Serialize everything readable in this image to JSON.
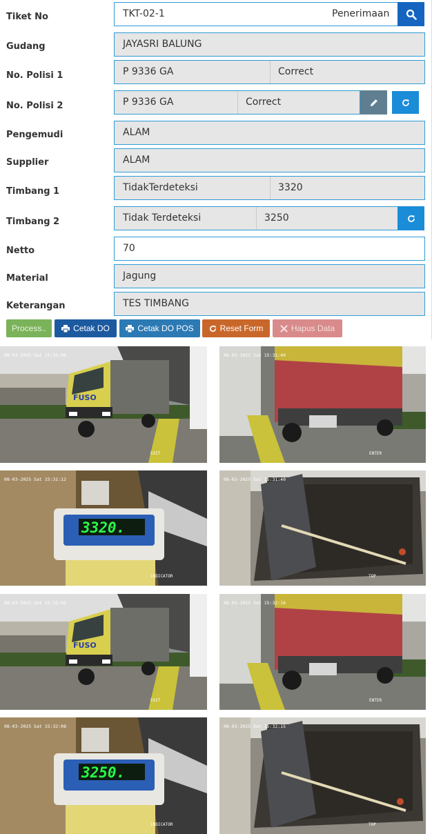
{
  "form": {
    "tiket_label": "Tiket No",
    "tiket_value": "TKT-02-1",
    "tiket_type": "Penerimaan",
    "gudang_label": "Gudang",
    "gudang_value": "JAYASRI BALUNG",
    "polisi1_label": "No. Polisi 1",
    "polisi1_value": "P 9336 GA",
    "polisi1_status": "Correct",
    "polisi2_label": "No. Polisi 2",
    "polisi2_value": "P 9336 GA",
    "polisi2_status": "Correct",
    "pengemudi_label": "Pengemudi",
    "pengemudi_value": "ALAM",
    "supplier_label": "Supplier",
    "supplier_value": "ALAM",
    "timbang1_label": "Timbang 1",
    "timbang1_status": "TidakTerdeteksi",
    "timbang1_value": "3320",
    "timbang2_label": "Timbang 2",
    "timbang2_status": "Tidak Terdeteksi",
    "timbang2_value": "3250",
    "netto_label": "Netto",
    "netto_value": "70",
    "material_label": "Material",
    "material_value": "Jagung",
    "keterangan_label": "Keterangan",
    "keterangan_value": "TES TIMBANG"
  },
  "actions": {
    "process": "Process..",
    "cetak_do": "Cetak DO",
    "cetak_do_pos": "Cetak DO POS",
    "reset_form": "Reset Form",
    "hapus_data": "Hapus Data"
  },
  "colors": {
    "process": "#7bb35a",
    "cetak_do": "#1c5aa0",
    "cetak_do_pos": "#2c7ab4",
    "reset_form": "#c9672a",
    "hapus_data": "#d98a8a",
    "field_border": "#2e9bd6"
  },
  "cameras": [
    {
      "timestamp": "08-03-2025 Sat 15:31:08",
      "label": "EXIT",
      "truck_text": "FUSO"
    },
    {
      "timestamp": "08-03-2025 Sat 15:31:40",
      "label": "ENTER"
    },
    {
      "timestamp": "08-03-2025 Sat 15:31:12",
      "label": "INDICATOR",
      "display": "3320."
    },
    {
      "timestamp": "08-03-2025 Sat 15:31:40",
      "label": "TOP"
    },
    {
      "timestamp": "08-03-2025 Sat 15:32:05",
      "label": "EXIT",
      "truck_text": "FUSO"
    },
    {
      "timestamp": "08-03-2025 Sat 15:32:16",
      "label": "ENTER"
    },
    {
      "timestamp": "08-03-2025 Sat 15:32:08",
      "label": "INDICATOR",
      "display": "3250."
    },
    {
      "timestamp": "08-03-2025 Sat 15:32:15",
      "label": "TOP"
    }
  ]
}
